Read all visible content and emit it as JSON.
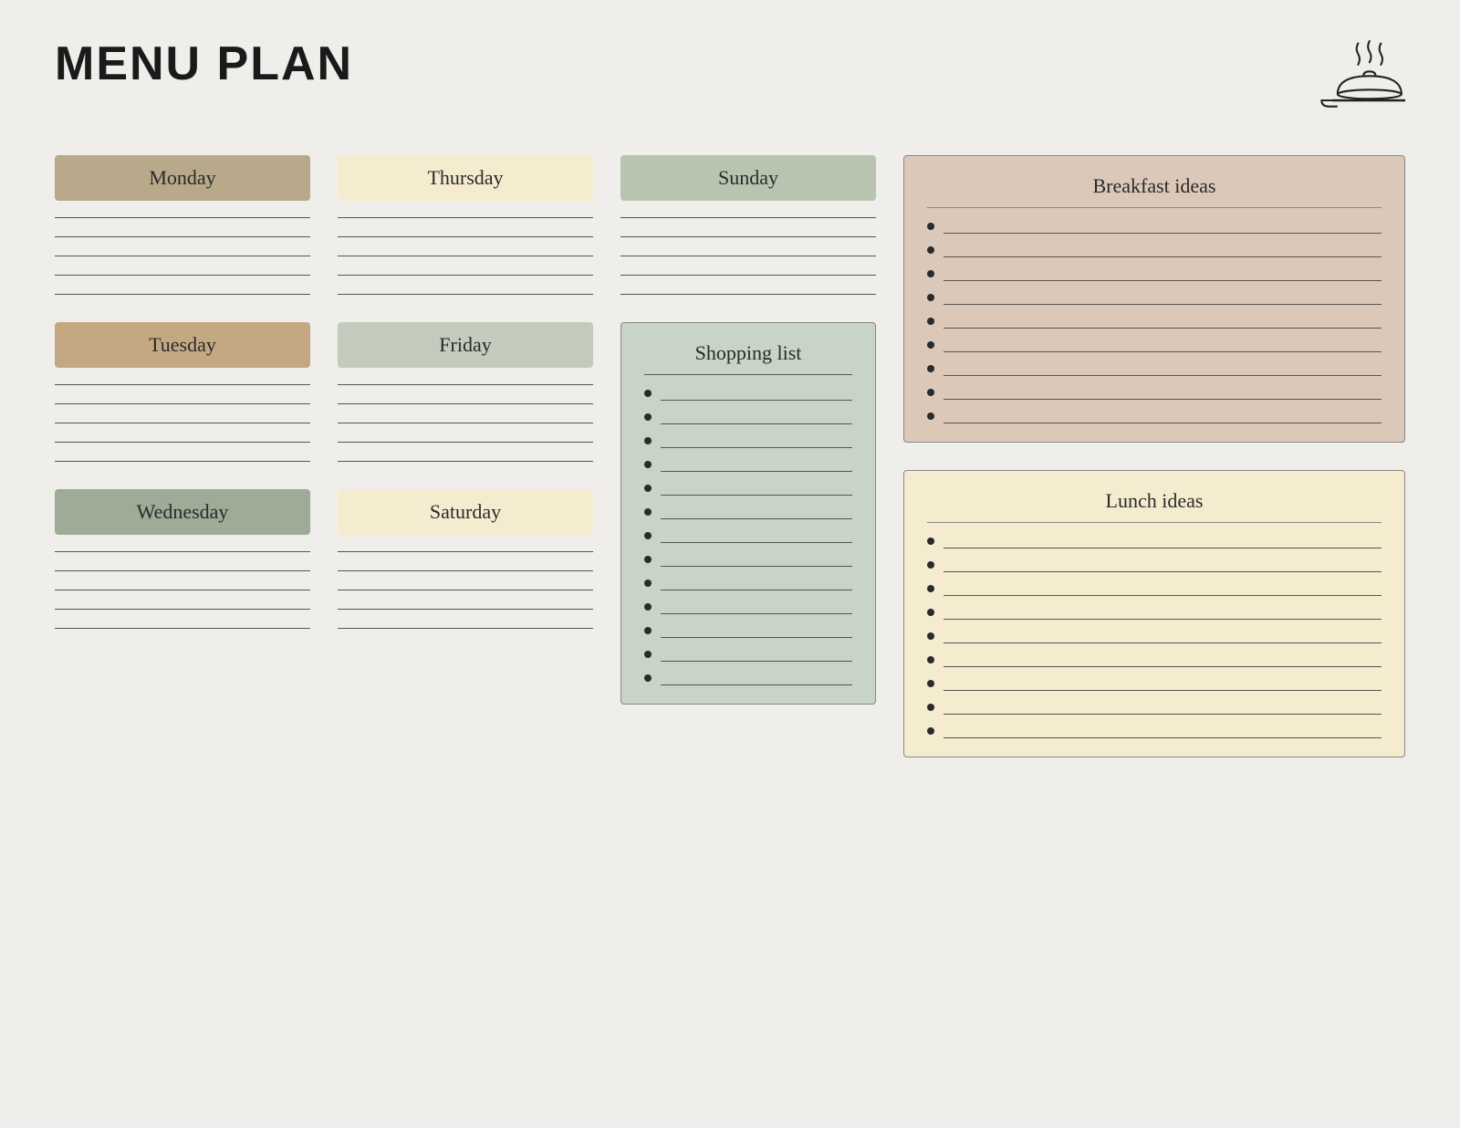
{
  "header": {
    "title": "MENU PLAN"
  },
  "days": {
    "monday": {
      "label": "Monday",
      "lines": 5
    },
    "thursday": {
      "label": "Thursday",
      "lines": 5
    },
    "sunday": {
      "label": "Sunday",
      "lines": 5
    },
    "tuesday": {
      "label": "Tuesday",
      "lines": 5
    },
    "friday": {
      "label": "Friday",
      "lines": 5
    },
    "wednesday": {
      "label": "Wednesday",
      "lines": 5
    },
    "saturday": {
      "label": "Saturday",
      "lines": 5
    }
  },
  "shopping": {
    "title": "Shopping list",
    "items": 13
  },
  "breakfast": {
    "title": "Breakfast ideas",
    "items": 9
  },
  "lunch": {
    "title": "Lunch ideas",
    "items": 9
  }
}
